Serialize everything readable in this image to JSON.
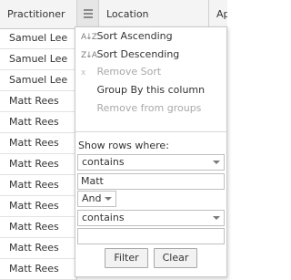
{
  "grid": {
    "columns": [
      {
        "label": "Practitioner"
      },
      {
        "label": "Location"
      },
      {
        "label": "Ap"
      }
    ],
    "rows": [
      "Samuel Lee",
      "Samuel Lee",
      "Samuel Lee",
      "Matt Rees",
      "Matt Rees",
      "Matt Rees",
      "Matt Rees",
      "Matt Rees",
      "Matt Rees",
      "Matt Rees",
      "Matt Rees",
      "Matt Rees"
    ]
  },
  "menu": {
    "sort_asc": {
      "icon": "A↓Z",
      "label": "Sort Ascending"
    },
    "sort_desc": {
      "icon": "Z↓A",
      "label": "Sort Descending"
    },
    "remove_sort": {
      "icon": "x",
      "label": "Remove Sort"
    },
    "group_by": {
      "label": "Group By this column"
    },
    "remove_groups": {
      "label": "Remove from groups"
    }
  },
  "filter": {
    "heading": "Show rows where:",
    "condition1": "contains",
    "value1": "Matt",
    "logic": "And",
    "condition2": "contains",
    "value2": "",
    "filter_button": "Filter",
    "clear_button": "Clear"
  },
  "colors": {
    "header_bg": "#f4f4f4",
    "border": "#c8c8c8",
    "disabled_text": "#a8a8a8"
  }
}
